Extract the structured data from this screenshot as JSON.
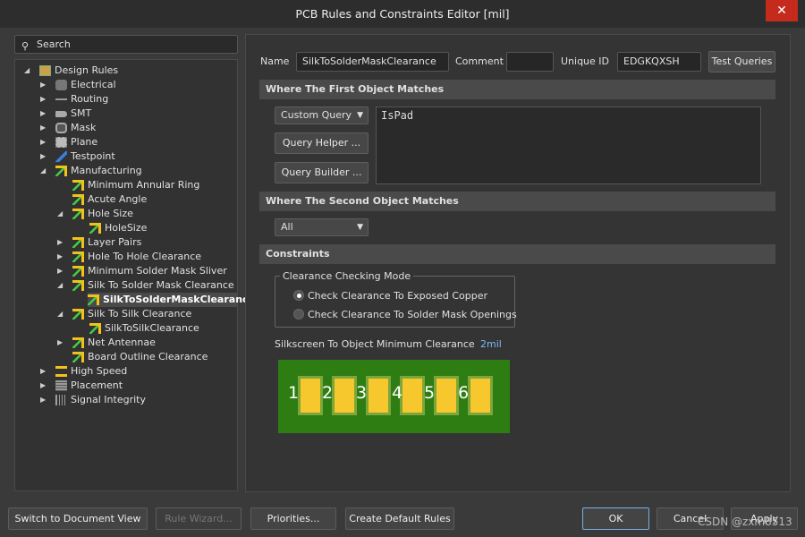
{
  "window": {
    "title": "PCB Rules and Constraints Editor [mil]",
    "close": "✕"
  },
  "search": {
    "placeholder": "Search",
    "icon": "search-icon"
  },
  "tree": [
    {
      "label": "Design Rules",
      "level": 0,
      "exp": "open",
      "icon": "folder"
    },
    {
      "label": "Electrical",
      "level": 1,
      "exp": "closed",
      "icon": "electrical"
    },
    {
      "label": "Routing",
      "level": 1,
      "exp": "closed",
      "icon": "routing"
    },
    {
      "label": "SMT",
      "level": 1,
      "exp": "closed",
      "icon": "smt"
    },
    {
      "label": "Mask",
      "level": 1,
      "exp": "closed",
      "icon": "mask"
    },
    {
      "label": "Plane",
      "level": 1,
      "exp": "closed",
      "icon": "plane"
    },
    {
      "label": "Testpoint",
      "level": 1,
      "exp": "closed",
      "icon": "testpoint"
    },
    {
      "label": "Manufacturing",
      "level": 1,
      "exp": "open",
      "icon": "rule"
    },
    {
      "label": "Minimum Annular Ring",
      "level": 2,
      "exp": "",
      "icon": "rule"
    },
    {
      "label": "Acute Angle",
      "level": 2,
      "exp": "",
      "icon": "rule"
    },
    {
      "label": "Hole Size",
      "level": 2,
      "exp": "open",
      "icon": "rule"
    },
    {
      "label": "HoleSize",
      "level": 3,
      "exp": "",
      "icon": "rule"
    },
    {
      "label": "Layer Pairs",
      "level": 2,
      "exp": "closed",
      "icon": "rule"
    },
    {
      "label": "Hole To Hole Clearance",
      "level": 2,
      "exp": "closed",
      "icon": "rule"
    },
    {
      "label": "Minimum Solder Mask Sliver",
      "level": 2,
      "exp": "closed",
      "icon": "rule"
    },
    {
      "label": "Silk To Solder Mask Clearance",
      "level": 2,
      "exp": "open",
      "icon": "rule"
    },
    {
      "label": "SilkToSolderMaskClearance*",
      "level": 3,
      "exp": "",
      "icon": "rule",
      "selected": true
    },
    {
      "label": "Silk To Silk Clearance",
      "level": 2,
      "exp": "open",
      "icon": "rule"
    },
    {
      "label": "SilkToSilkClearance",
      "level": 3,
      "exp": "",
      "icon": "rule"
    },
    {
      "label": "Net Antennae",
      "level": 2,
      "exp": "closed",
      "icon": "rule"
    },
    {
      "label": "Board Outline Clearance",
      "level": 2,
      "exp": "",
      "icon": "rule"
    },
    {
      "label": "High Speed",
      "level": 1,
      "exp": "closed",
      "icon": "highspeed"
    },
    {
      "label": "Placement",
      "level": 1,
      "exp": "closed",
      "icon": "placement"
    },
    {
      "label": "Signal Integrity",
      "level": 1,
      "exp": "closed",
      "icon": "signal"
    }
  ],
  "rule": {
    "name_label": "Name",
    "name": "SilkToSolderMaskClearance",
    "comment_label": "Comment",
    "comment": "",
    "uid_label": "Unique ID",
    "uid": "EDGKQXSH",
    "test_queries": "Test Queries"
  },
  "first": {
    "title": "Where The First Object Matches",
    "type": "Custom Query",
    "helper": "Query Helper ...",
    "builder": "Query Builder ...",
    "query": "IsPad"
  },
  "second": {
    "title": "Where The Second Object Matches",
    "type": "All"
  },
  "constraints": {
    "title": "Constraints",
    "group": "Clearance Checking Mode",
    "opt1": "Check Clearance To Exposed Copper",
    "opt2": "Check Clearance To Solder Mask Openings",
    "selected": 1,
    "min_label": "Silkscreen To Object Minimum Clearance",
    "min_value": "2mil",
    "pads": [
      "1",
      "2",
      "3",
      "4",
      "5",
      "6"
    ]
  },
  "footer": {
    "switch": "Switch to Document View",
    "wizard": "Rule Wizard...",
    "priorities": "Priorities...",
    "defaults": "Create Default Rules",
    "ok": "OK",
    "cancel": "Cancel",
    "apply": "Apply"
  },
  "watermark": "CSDN @zxm8513",
  "colors": {
    "board": "#2e7d13",
    "pad": "#f6c82d",
    "accent": "#7ab8f5"
  }
}
